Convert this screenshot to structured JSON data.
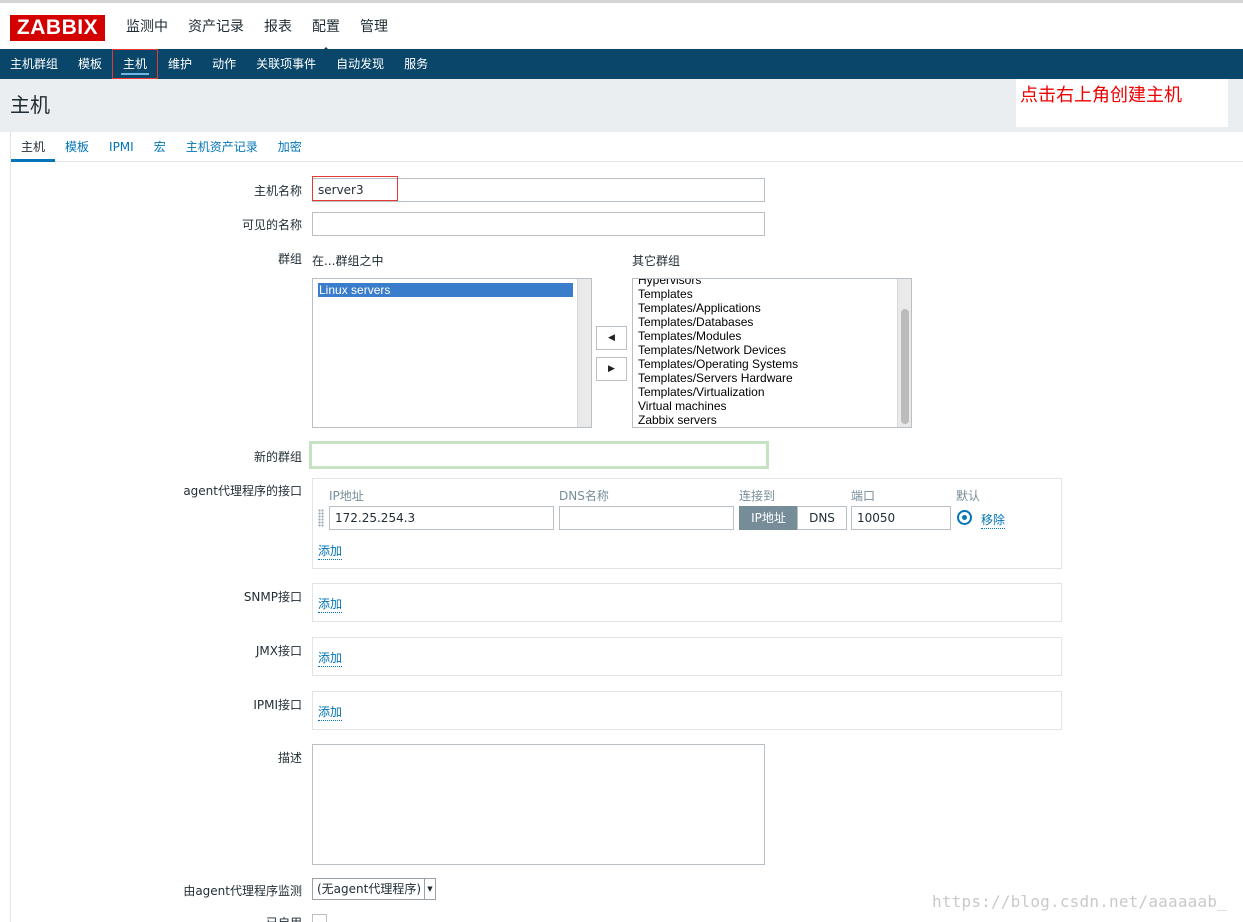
{
  "logo": "ZABBIX",
  "top_nav": [
    "监测中",
    "资产记录",
    "报表",
    "配置",
    "管理"
  ],
  "sub_nav": [
    "主机群组",
    "模板",
    "主机",
    "维护",
    "动作",
    "关联项事件",
    "自动发现",
    "服务"
  ],
  "page_title": "主机",
  "annotation": "点击右上角创建主机",
  "tabs": [
    "主机",
    "模板",
    "IPMI",
    "宏",
    "主机资产记录",
    "加密"
  ],
  "form": {
    "host_name_label": "主机名称",
    "host_name_value": "server3",
    "visible_name_label": "可见的名称",
    "visible_name_value": "",
    "groups_label": "群组",
    "in_groups_label": "在...群组之中",
    "other_groups_label": "其它群组",
    "in_groups": [
      "Linux servers"
    ],
    "other_groups": [
      "Hypervisors",
      "Templates",
      "Templates/Applications",
      "Templates/Databases",
      "Templates/Modules",
      "Templates/Network Devices",
      "Templates/Operating Systems",
      "Templates/Servers Hardware",
      "Templates/Virtualization",
      "Virtual machines",
      "Zabbix servers"
    ],
    "new_group_label": "新的群组",
    "new_group_value": "",
    "agent_label": "agent代理程序的接口",
    "columns": {
      "ip": "IP地址",
      "dns": "DNS名称",
      "connect": "连接到",
      "port": "端口",
      "default": "默认"
    },
    "agent_ip": "172.25.254.3",
    "agent_dns": "",
    "connect_ip": "IP地址",
    "connect_dns": "DNS",
    "agent_port": "10050",
    "remove": "移除",
    "add": "添加",
    "snmp_label": "SNMP接口",
    "jmx_label": "JMX接口",
    "ipmi_label": "IPMI接口",
    "description_label": "描述",
    "description_value": "",
    "proxy_label": "由agent代理程序监测",
    "proxy_value": "(无agent代理程序)",
    "enabled_label": "已启用"
  },
  "watermark": "https://blog.csdn.net/aaaaaab_"
}
